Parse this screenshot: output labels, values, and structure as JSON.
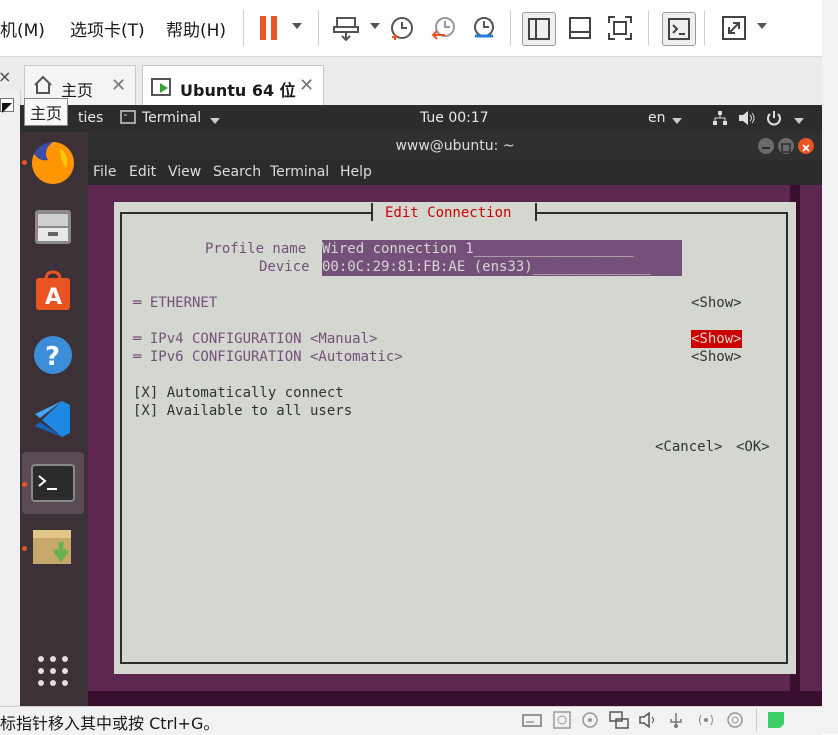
{
  "vm_menu": {
    "machine": "机(M)",
    "tabs_menu": "选项卡(T)",
    "help": "帮助(H)"
  },
  "tabs": [
    {
      "label": "主页"
    },
    {
      "label": "Ubuntu 64 位"
    }
  ],
  "tooltip": "主页",
  "ubuntu_panel": {
    "activities": "ties",
    "app_menu": "Terminal",
    "clock": "Tue 00:17",
    "lang": "en"
  },
  "terminal": {
    "title": "www@ubuntu: ~",
    "menu": [
      "File",
      "Edit",
      "View",
      "Search",
      "Terminal",
      "Help"
    ]
  },
  "nmtui": {
    "title": "Edit Connection",
    "profile_label": "Profile name",
    "profile_value": "Wired connection 1",
    "profile_fill": "___________________",
    "device_label": "Device",
    "device_value": "00:0C:29:81:FB:AE (ens33)",
    "device_fill": "______________",
    "ethernet": "═ ETHERNET",
    "ethernet_action": "<Show>",
    "ipv4": "═ IPv4 CONFIGURATION <Manual>",
    "ipv4_action": "<Show>",
    "ipv6": "═ IPv6 CONFIGURATION <Automatic>",
    "ipv6_action": "<Show>",
    "auto_connect": "[X] Automatically connect",
    "all_users": "[X] Available to all users",
    "cancel": "<Cancel>",
    "ok": "<OK>"
  },
  "status": {
    "text": "标指针移入其中或按 Ctrl+G。"
  },
  "colors": {
    "ubuntu_orange": "#e95420",
    "term_purple": "#5e2750",
    "dialog_bg": "#d3d7cf",
    "accent_red": "#cc0000"
  }
}
